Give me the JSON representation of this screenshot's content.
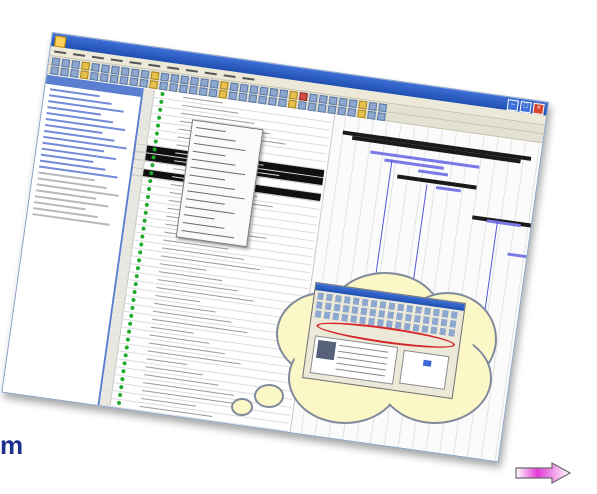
{
  "slide": {
    "partial_heading": "m"
  },
  "screenshot": {
    "icons": [
      "app-icon",
      "minimize-icon",
      "maximize-icon",
      "close-icon"
    ],
    "menu_count": 11,
    "row_count": 40
  },
  "colors": {
    "heading": "#1b2f8c",
    "cloud_fill": "#fcf7c6",
    "highlight_ellipse": "#d4282a",
    "arrow_fill": "#e23ad6"
  },
  "navigation": {
    "next_arrow_icon": "right-arrow-icon"
  }
}
